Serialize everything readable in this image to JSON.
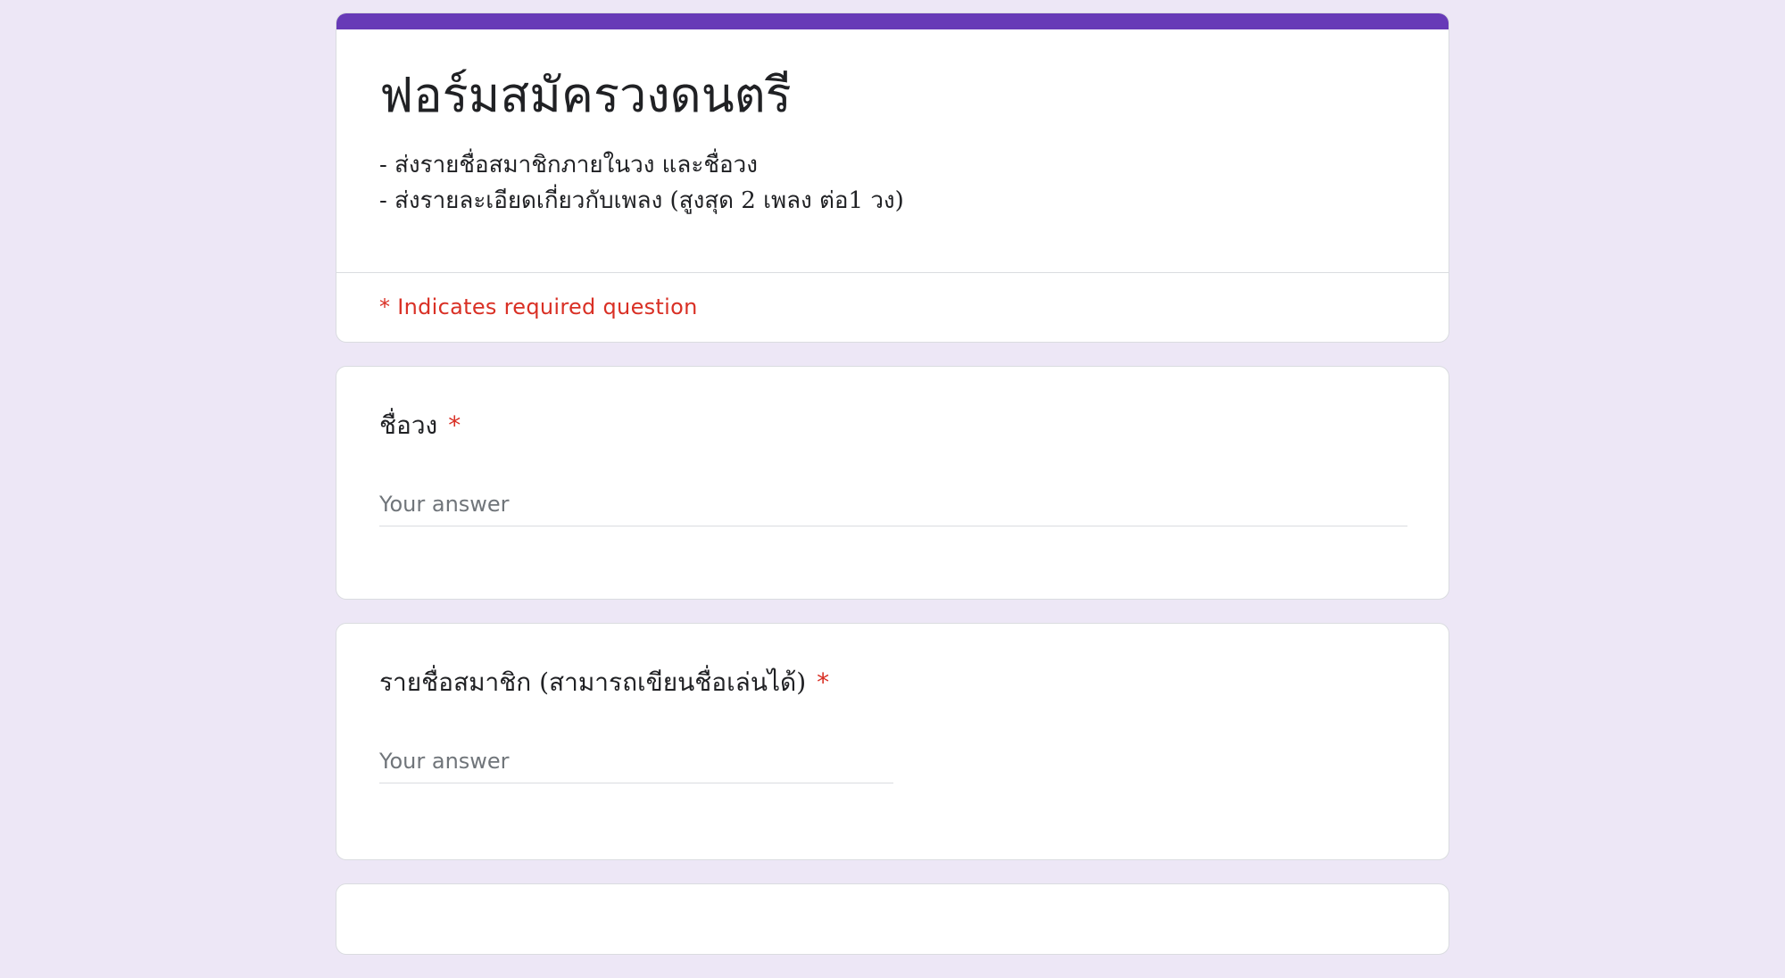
{
  "form": {
    "title": "ฟอร์มสมัครวงดนตรี",
    "description": [
      "- ส่งรายชื่อสมาชิกภายในวง และชื่อวง",
      "- ส่งรายละเอียดเกี่ยวกับเพลง (สูงสุด 2 เพลง ต่อ1 วง)"
    ],
    "required_note": "* Indicates required question",
    "accent_color": "#673ab7",
    "background_color": "#ede7f6"
  },
  "questions": [
    {
      "title": "ชื่อวง",
      "required_marker": "*",
      "placeholder": "Your answer"
    },
    {
      "title": "รายชื่อสมาชิก (สามารถเขียนชื่อเล่นได้)",
      "required_marker": "*",
      "placeholder": "Your answer"
    }
  ]
}
